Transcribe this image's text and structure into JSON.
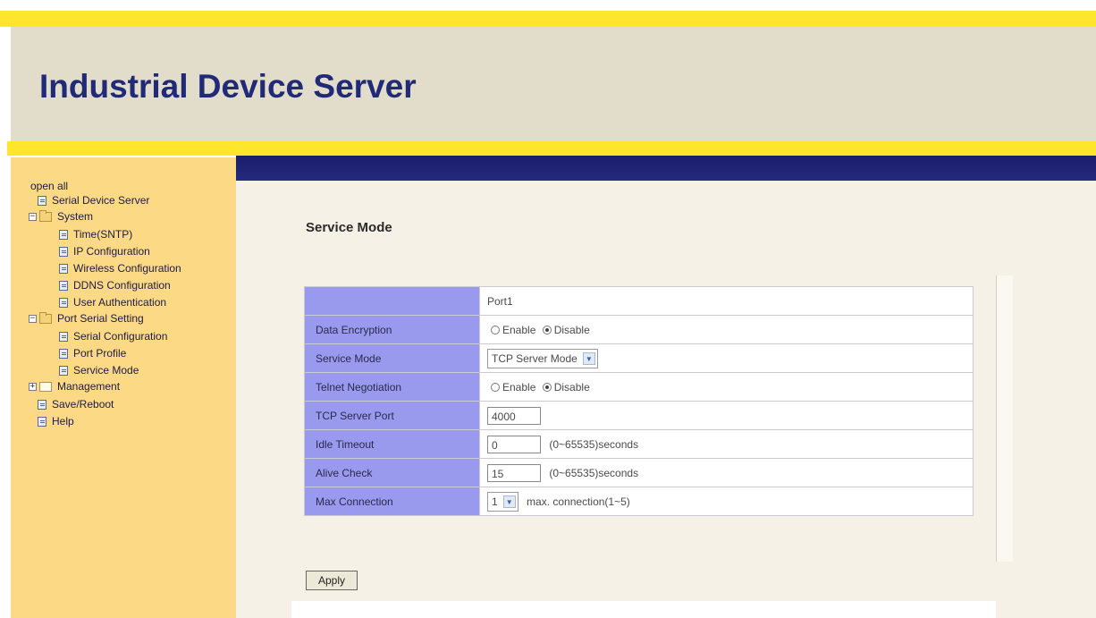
{
  "header": {
    "title": "Industrial Device Server"
  },
  "sidebar": {
    "open_all": "open all",
    "items": [
      {
        "label": "Serial Device Server"
      },
      {
        "label": "System"
      },
      {
        "label": "Time(SNTP)"
      },
      {
        "label": "IP Configuration"
      },
      {
        "label": "Wireless Configuration"
      },
      {
        "label": "DDNS Configuration"
      },
      {
        "label": "User Authentication"
      },
      {
        "label": "Port Serial Setting"
      },
      {
        "label": "Serial Configuration"
      },
      {
        "label": "Port Profile"
      },
      {
        "label": "Service Mode"
      },
      {
        "label": "Management"
      },
      {
        "label": "Save/Reboot"
      },
      {
        "label": "Help"
      }
    ]
  },
  "main": {
    "page_title": "Service Mode",
    "port_header": "Port1",
    "data_encryption": {
      "label": "Data Encryption",
      "enable": "Enable",
      "disable": "Disable",
      "selected": "Disable"
    },
    "service_mode": {
      "label": "Service Mode",
      "value": "TCP Server Mode"
    },
    "telnet_negotiation": {
      "label": "Telnet Negotiation",
      "enable": "Enable",
      "disable": "Disable",
      "selected": "Disable"
    },
    "tcp_server_port": {
      "label": "TCP Server Port",
      "value": "4000"
    },
    "idle_timeout": {
      "label": "Idle Timeout",
      "value": "0",
      "hint": "(0~65535)seconds"
    },
    "alive_check": {
      "label": "Alive Check",
      "value": "15",
      "hint": "(0~65535)seconds"
    },
    "max_connection": {
      "label": "Max Connection",
      "value": "1",
      "hint": "max. connection(1~5)"
    },
    "apply_label": "Apply"
  },
  "colors": {
    "stripe": "#fde62c",
    "header_bg": "#e2dccb",
    "title": "#202a76",
    "sidebar_bg": "#fcd985",
    "navy_bar": "#1a1d6a",
    "label_cell": "#9999ee",
    "content_bg": "#f6f1e7"
  }
}
